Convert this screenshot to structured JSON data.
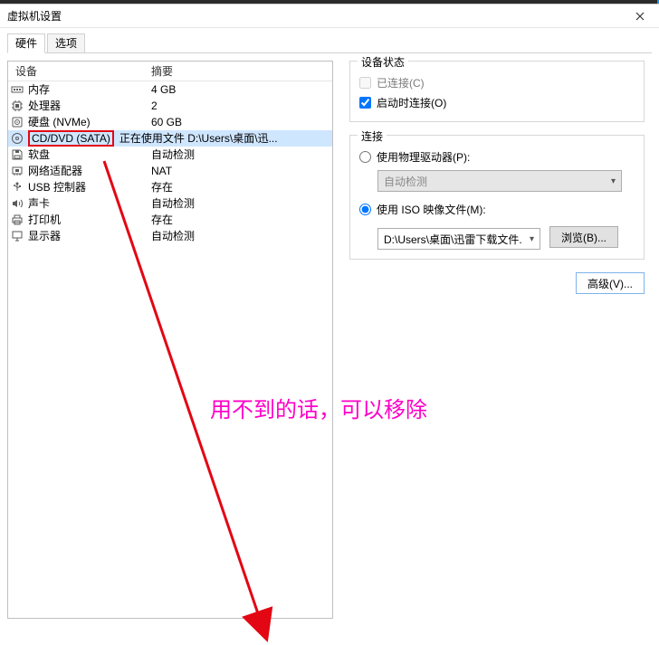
{
  "window": {
    "title": "虚拟机设置"
  },
  "tabs": {
    "hardware": "硬件",
    "options": "选项"
  },
  "hw": {
    "col_device": "设备",
    "col_summary": "摘要",
    "rows": [
      {
        "name": "内存",
        "summary": "4 GB"
      },
      {
        "name": "处理器",
        "summary": "2"
      },
      {
        "name": "硬盘 (NVMe)",
        "summary": "60 GB"
      },
      {
        "name": "CD/DVD (SATA)",
        "summary": "正在使用文件 D:\\Users\\桌面\\迅..."
      },
      {
        "name": "软盘",
        "summary": "自动检测"
      },
      {
        "name": "网络适配器",
        "summary": "NAT"
      },
      {
        "name": "USB 控制器",
        "summary": "存在"
      },
      {
        "name": "声卡",
        "summary": "自动检测"
      },
      {
        "name": "打印机",
        "summary": "存在"
      },
      {
        "name": "显示器",
        "summary": "自动检测"
      }
    ]
  },
  "right": {
    "status_legend": "设备状态",
    "connected": "已连接(C)",
    "connect_on": "启动时连接(O)",
    "conn_legend": "连接",
    "use_drive": "使用物理驱动器(P):",
    "auto_detect": "自动检测",
    "use_iso": "使用 ISO 映像文件(M):",
    "iso_path": "D:\\Users\\桌面\\迅雷下载文件.",
    "browse": "浏览(B)...",
    "advanced": "高级(V)..."
  },
  "annot": {
    "text": "用不到的话，可以移除"
  },
  "icons": {
    "memory": "memory-icon",
    "cpu": "cpu-icon",
    "disk": "disk-icon",
    "cd": "cd-icon",
    "floppy": "floppy-icon",
    "nic": "nic-icon",
    "usb": "usb-icon",
    "sound": "sound-icon",
    "printer": "printer-icon",
    "display": "display-icon"
  }
}
